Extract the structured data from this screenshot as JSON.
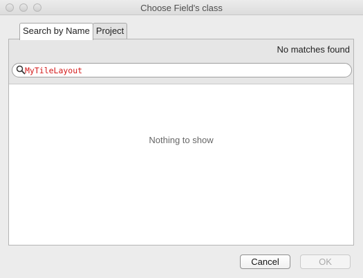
{
  "window": {
    "title": "Choose Field's class"
  },
  "tabs": [
    {
      "label": "Search by Name",
      "active": true
    },
    {
      "label": "Project",
      "active": false
    }
  ],
  "status": {
    "text": "No matches found"
  },
  "search": {
    "value": "MyTileLayout",
    "icon": "search-icon"
  },
  "results": {
    "empty_text": "Nothing to show"
  },
  "buttons": {
    "cancel_label": "Cancel",
    "ok_label": "OK"
  },
  "colors": {
    "search_text": "#d31919"
  }
}
